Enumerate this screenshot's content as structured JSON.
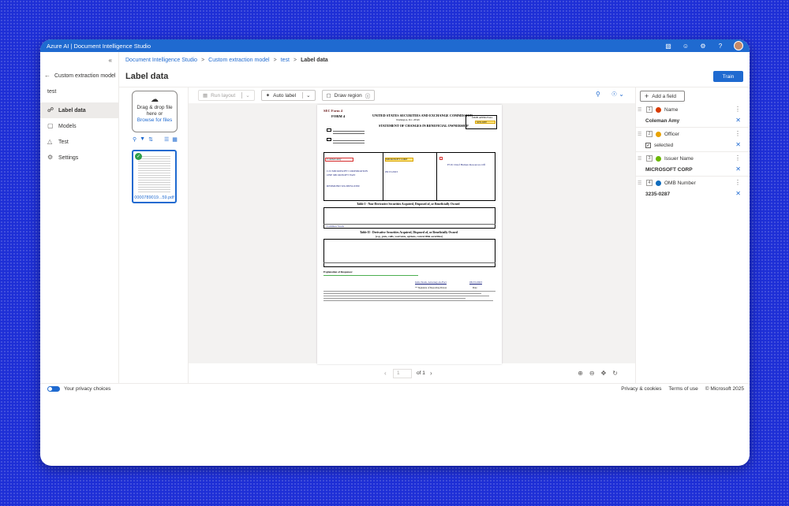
{
  "app": {
    "title": "Azure AI | Document Intelligence Studio"
  },
  "topbar": {
    "icons": [
      "notification-icon",
      "smiley-icon",
      "gear-icon",
      "help-icon",
      "avatar"
    ]
  },
  "nav": {
    "collapse_glyph": "«",
    "header": "Custom extraction model",
    "project": "test",
    "items": [
      {
        "label": "Label data",
        "icon": "tag-icon",
        "active": true
      },
      {
        "label": "Models",
        "icon": "cube-icon",
        "active": false
      },
      {
        "label": "Test",
        "icon": "flask-icon",
        "active": false
      },
      {
        "label": "Settings",
        "icon": "gear-icon",
        "active": false
      }
    ]
  },
  "breadcrumb": [
    "Document Intelligence Studio",
    "Custom extraction model",
    "test",
    "Label data"
  ],
  "page": {
    "title": "Label data",
    "train_label": "Train"
  },
  "files": {
    "drop_line1": "Drag & drop file",
    "drop_line2": "here or",
    "browse_label": "Browse for files",
    "thumbnail_name": "0000789019...59.pdf"
  },
  "toolbar": {
    "run_layout": "Run layout",
    "auto_label": "Auto label",
    "draw_region": "Draw region"
  },
  "document": {
    "sec_form": "SEC Form 4",
    "form": "FORM 4",
    "agency": "UNITED STATES SECURITIES AND EXCHANGE COMMISSION",
    "city": "Washington, D.C. 20549",
    "statement": "STATEMENT OF CHANGES IN BENEFICIAL OWNERSHIP",
    "omb_approval": "OMB APPROVAL",
    "omb_number": "3235-0287",
    "reporting_person": "Coleman Amy",
    "issuer": "MICROSOFT CORP",
    "address1": "C/O MICROSOFT CORPORATION",
    "address2": "ONE MICROSOFT WAY",
    "city_state": "REDMOND   WA   98052-6399",
    "date": "08/15/2023",
    "officer_title": "EVP, Chief Human Resources Off",
    "table1": "Table I - Non-Derivative Securities Acquired, Disposed of, or Beneficially Owned",
    "table2": "Table II - Derivative Securities Acquired, Disposed of, or Beneficially Owned",
    "table2_sub": "(e.g., puts, calls, warrants, options, convertible securities)",
    "row_security": "Common Stock",
    "explanation": "Explanation of Responses:",
    "signature": "Julia Stark, Attorney-in-Fact",
    "signature_date": "08/15/2023",
    "sig_caption": "** Signature of Reporting Person",
    "sig_date_caption": "Date"
  },
  "pager": {
    "current": "1",
    "of_label": "of 1"
  },
  "fields": {
    "add_label": "Add a field",
    "items": [
      {
        "index": "1",
        "name": "Name",
        "color": "#d83b01",
        "value": "Coleman Amy",
        "is_checkbox": false
      },
      {
        "index": "2",
        "name": "Officer",
        "color": "#e8a200",
        "value": "selected",
        "is_checkbox": true
      },
      {
        "index": "3",
        "name": "Issuer Name",
        "color": "#6bb700",
        "value": "MICROSOFT CORP",
        "is_checkbox": false
      },
      {
        "index": "4",
        "name": "OMB Number",
        "color": "#0f6cbd",
        "value": "3235-0287",
        "is_checkbox": false
      }
    ]
  },
  "footer": {
    "privacy": "Your privacy choices",
    "cookies": "Privacy & cookies",
    "terms": "Terms of use",
    "copyright": "© Microsoft 2025"
  }
}
